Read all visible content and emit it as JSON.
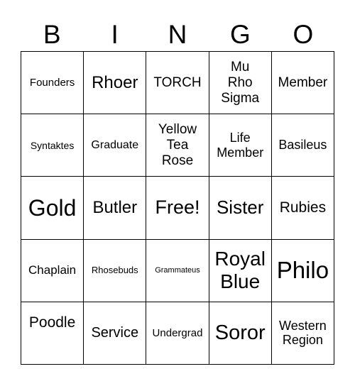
{
  "header": [
    "B",
    "I",
    "N",
    "G",
    "O"
  ],
  "cells": [
    {
      "text": "Founders",
      "size": 15
    },
    {
      "text": "Rhoer",
      "size": 24
    },
    {
      "text": "TORCH",
      "size": 19
    },
    {
      "text": "Mu Rho Sigma",
      "size": 19,
      "lines": [
        "Mu",
        "Rho",
        "Sigma"
      ]
    },
    {
      "text": "Member",
      "size": 19
    },
    {
      "text": "Syntaktes",
      "size": 14
    },
    {
      "text": "Graduate",
      "size": 16
    },
    {
      "text": "Yellow Tea Rose",
      "size": 19,
      "lines": [
        "Yellow",
        "Tea",
        "Rose"
      ]
    },
    {
      "text": "Life Member",
      "size": 18,
      "lines": [
        "Life",
        "Member"
      ]
    },
    {
      "text": "Basileus",
      "size": 18
    },
    {
      "text": "Gold",
      "size": 32
    },
    {
      "text": "Butler",
      "size": 24
    },
    {
      "text": "Free!",
      "size": 27
    },
    {
      "text": "Sister",
      "size": 26
    },
    {
      "text": "Rubies",
      "size": 21
    },
    {
      "text": "Chaplain",
      "size": 17
    },
    {
      "text": "Rhosebuds",
      "size": 13
    },
    {
      "text": "Grammateus",
      "size": 11
    },
    {
      "text": "Royal Blue",
      "size": 28,
      "lines": [
        "Royal",
        "Blue"
      ]
    },
    {
      "text": "Philo",
      "size": 33
    },
    {
      "text": "Poodle",
      "size": 21,
      "top": true
    },
    {
      "text": "Service",
      "size": 20
    },
    {
      "text": "Undergrad",
      "size": 15
    },
    {
      "text": "Soror",
      "size": 29
    },
    {
      "text": "Western Region",
      "size": 18,
      "lines": [
        "Western",
        "Region"
      ]
    }
  ]
}
